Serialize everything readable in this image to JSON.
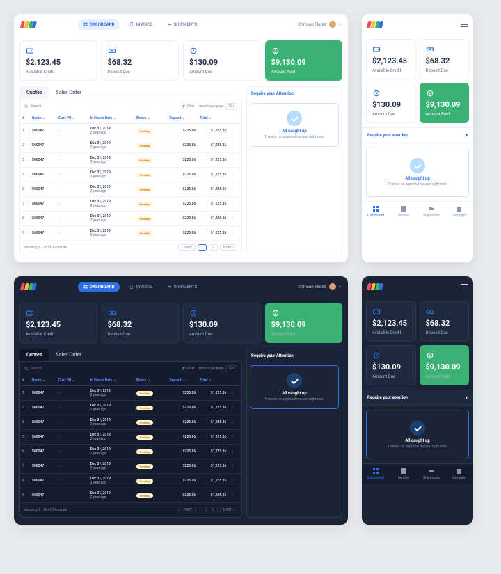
{
  "user": {
    "name": "Crimson Florist"
  },
  "nav": {
    "dashboard": "DASHBOARD",
    "invoice": "INVOICE",
    "shipments": "SHIPMENTS"
  },
  "cards": {
    "credit": {
      "amount": "$2,123.45",
      "label": "Available Credit"
    },
    "deposit": {
      "amount": "$68.32",
      "label": "Deposit Due"
    },
    "due": {
      "amount": "$130.09",
      "label": "Amount Due"
    },
    "paid": {
      "amount": "$9,130.09",
      "label": "Amount Paid"
    }
  },
  "tabs": {
    "quotes": "Quotes",
    "sales": "Sales Order"
  },
  "search": {
    "placeholder": "Search"
  },
  "filter_label": "Filter",
  "perpage_label": "results per page",
  "perpage_value": "10",
  "columns": {
    "idx": "#",
    "quote": "Quote",
    "custpo": "Cust.PO",
    "inhands": "In Hands Date",
    "status": "Status",
    "deposit": "Deposit",
    "total": "Total"
  },
  "rows": [
    {
      "idx": "1",
      "quote": "S00047",
      "custpo": "-",
      "date": "Dec 31, 2019",
      "age": "2 year ago",
      "status": "Pending",
      "deposit": "$225.86",
      "total": "$1,225.86"
    },
    {
      "idx": "2",
      "quote": "S00047",
      "custpo": "-",
      "date": "Dec 31, 2019",
      "age": "2 year ago",
      "status": "Pending",
      "deposit": "$225.86",
      "total": "$1,225.86"
    },
    {
      "idx": "3",
      "quote": "S00047",
      "custpo": "-",
      "date": "Dec 31, 2019",
      "age": "2 year ago",
      "status": "Pending",
      "deposit": "$225.86",
      "total": "$1,225.86"
    },
    {
      "idx": "5",
      "quote": "S00047",
      "custpo": "-",
      "date": "Dec 31, 2019",
      "age": "2 year ago",
      "status": "Pending",
      "deposit": "$225.86",
      "total": "$1,225.86"
    },
    {
      "idx": "6",
      "quote": "S00047",
      "custpo": "-",
      "date": "Dec 31, 2019",
      "age": "2 year ago",
      "status": "Pending",
      "deposit": "$225.86",
      "total": "$1,225.86"
    },
    {
      "idx": "7",
      "quote": "S00047",
      "custpo": "-",
      "date": "Dec 31, 2019",
      "age": "2 year ago",
      "status": "Pending",
      "deposit": "$225.86",
      "total": "$1,225.86"
    },
    {
      "idx": "8",
      "quote": "S00047",
      "custpo": "-",
      "date": "Dec 31, 2019",
      "age": "2 year ago",
      "status": "Pending",
      "deposit": "$225.86",
      "total": "$1,225.86"
    },
    {
      "idx": "9",
      "quote": "S00047",
      "custpo": "-",
      "date": "Dec 31, 2019",
      "age": "2 year ago",
      "status": "Pending",
      "deposit": "$225.86",
      "total": "$1,225.86"
    }
  ],
  "pager": {
    "showing": "showing 1 - 10 of 30 results",
    "prev": "PREV",
    "next": "NEXT",
    "p1": "1",
    "p2": "2"
  },
  "attention": {
    "title": "Require your Attention",
    "title_mobile": "Require your atention",
    "heading": "All caught up",
    "sub": "There is no approval request right now."
  },
  "bottomnav": {
    "dash": "Dashboard",
    "inv": "Invoice",
    "ship": "Shipments",
    "comp": "Company"
  }
}
